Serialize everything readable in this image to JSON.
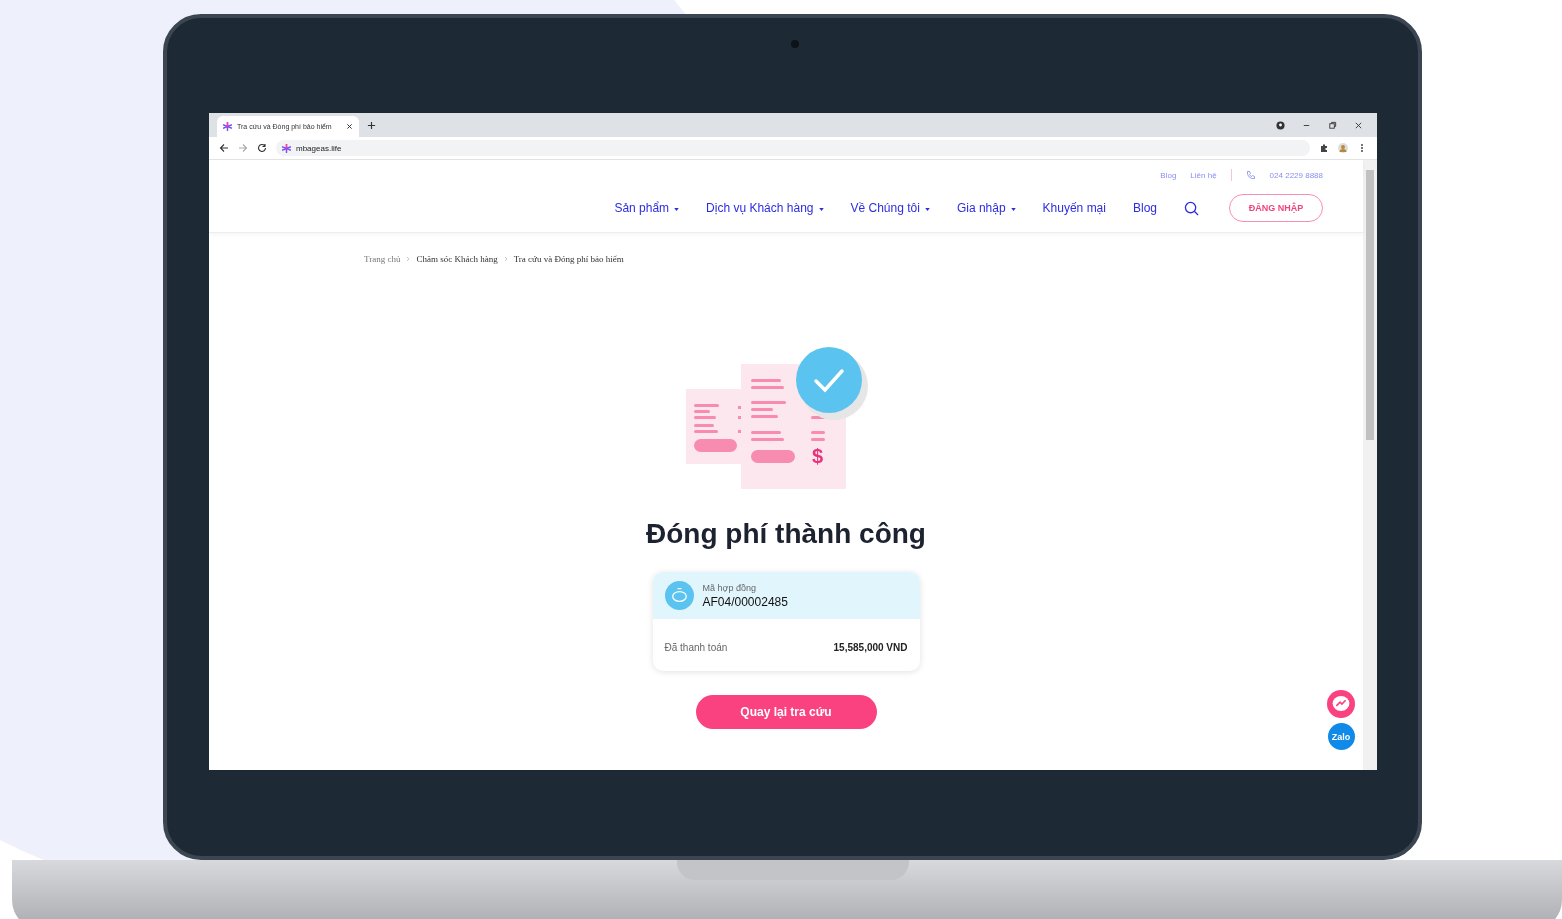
{
  "browser": {
    "tab_title": "Tra cứu và Đóng phí bảo hiểm",
    "url": "mbageas.life"
  },
  "top_links": [
    "Blog",
    "Liên hệ"
  ],
  "phone": "024 2229 8888",
  "nav": [
    {
      "label": "Sản phẩm",
      "dropdown": true
    },
    {
      "label": "Dịch vụ Khách hàng",
      "dropdown": true
    },
    {
      "label": "Về Chúng tôi",
      "dropdown": true
    },
    {
      "label": "Gia nhập",
      "dropdown": true
    },
    {
      "label": "Khuyến mại",
      "dropdown": false
    },
    {
      "label": "Blog",
      "dropdown": false
    }
  ],
  "login_button": "ĐĂNG NHẬP",
  "breadcrumb": [
    "Trang chủ",
    "Chăm sóc Khách hàng",
    "Tra cứu và Đóng phí bảo hiểm"
  ],
  "illustration": {
    "currency_symbol": "$"
  },
  "title": "Đóng phí thành công",
  "contract": {
    "label": "Mã hợp đồng",
    "number": "AF04/00002485"
  },
  "payment": {
    "label": "Đã thanh toán",
    "amount": "15,585,000 VND"
  },
  "back_button": "Quay lại tra cứu",
  "chat": {
    "zalo_label": "Zalo"
  }
}
